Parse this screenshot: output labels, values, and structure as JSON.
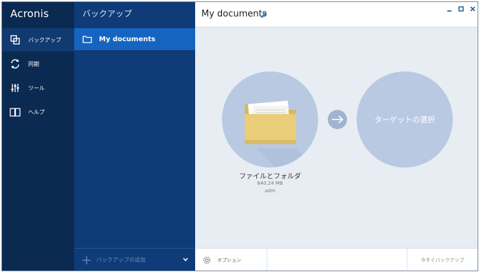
{
  "app": {
    "logo": "Acronis"
  },
  "nav": {
    "items": [
      {
        "label": "バックアップ",
        "icon": "backup-icon"
      },
      {
        "label": "同期",
        "icon": "sync-icon"
      },
      {
        "label": "ツール",
        "icon": "tools-icon"
      },
      {
        "label": "ヘルプ",
        "icon": "help-book-icon"
      }
    ]
  },
  "backups": {
    "title": "バックアップ",
    "items": [
      {
        "label": "My documents",
        "icon": "folder-icon"
      }
    ],
    "add_label": "バックアップの追加"
  },
  "main": {
    "title": "My documents",
    "source": {
      "label": "ファイルとフォルダ",
      "size": "640.24 MB",
      "user": "adm"
    },
    "target": {
      "label": "ターゲットの選択"
    },
    "footer": {
      "options_label": "オプション",
      "backup_now_label": "今すぐバックアップ"
    }
  },
  "colors": {
    "nav_bg": "#0b2a52",
    "list_bg": "#0f3b78",
    "selected_item": "#1565c0",
    "main_bg": "#e8edf4",
    "circle": "#b8c9e1",
    "accent_icon": "#2f7de0"
  }
}
